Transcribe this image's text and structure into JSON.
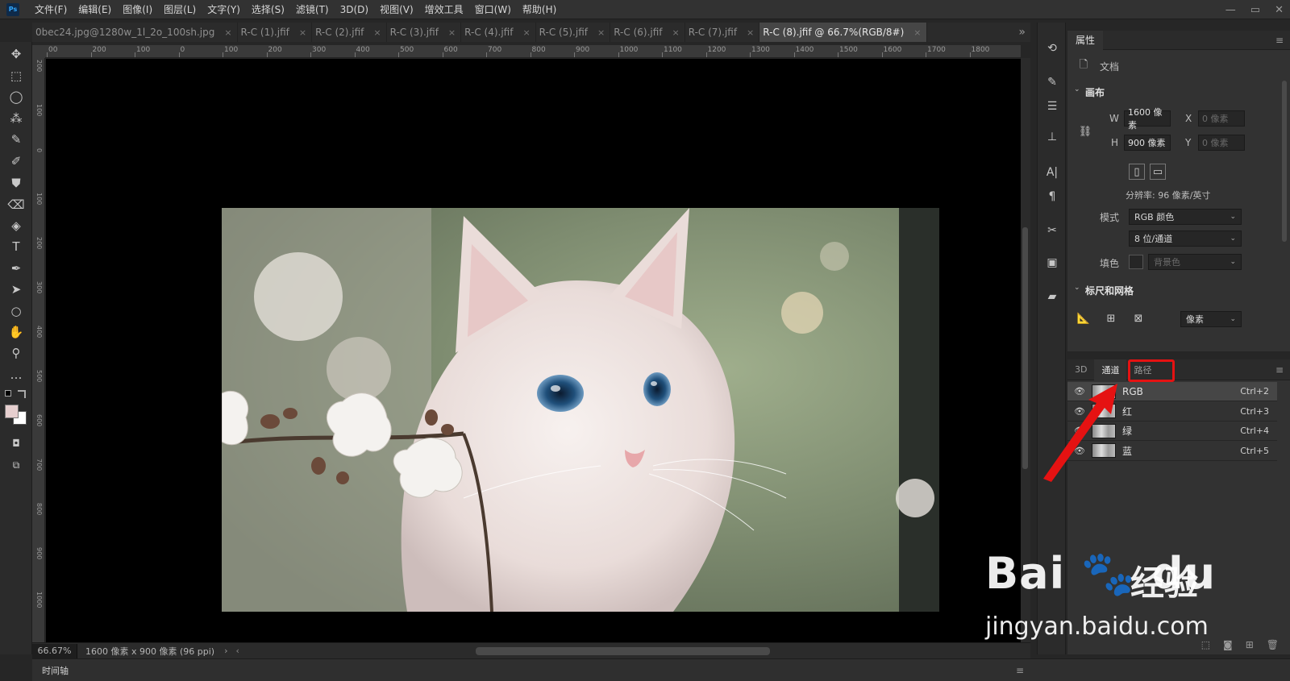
{
  "app": {
    "logo": "Ps"
  },
  "menu": [
    "文件(F)",
    "编辑(E)",
    "图像(I)",
    "图层(L)",
    "文字(Y)",
    "选择(S)",
    "滤镜(T)",
    "3D(D)",
    "视图(V)",
    "增效工具",
    "窗口(W)",
    "帮助(H)"
  ],
  "window_controls": {
    "minimize": "—",
    "restore": "▭",
    "close": "✕"
  },
  "tabs": [
    {
      "label": "0bec24.jpg@1280w_1l_2o_100sh.jpg",
      "close": "×"
    },
    {
      "label": "R-C (1).jfif",
      "close": "×"
    },
    {
      "label": "R-C (2).jfif",
      "close": "×"
    },
    {
      "label": "R-C (3).jfif",
      "close": "×"
    },
    {
      "label": "R-C (4).jfif",
      "close": "×"
    },
    {
      "label": "R-C (5).jfif",
      "close": "×"
    },
    {
      "label": "R-C (6).jfif",
      "close": "×"
    },
    {
      "label": "R-C (7).jfif",
      "close": "×"
    },
    {
      "label": "R-C (8).jfif @ 66.7%(RGB/8#)",
      "close": "×",
      "active": true
    }
  ],
  "tab_overflow": "»",
  "tools": [
    {
      "name": "move-tool",
      "glyph": "✥"
    },
    {
      "name": "marquee-tool",
      "glyph": "⬚"
    },
    {
      "name": "lasso-tool",
      "glyph": "◯"
    },
    {
      "name": "magic-wand-tool",
      "glyph": "⁂"
    },
    {
      "name": "eyedropper-tool",
      "glyph": "✎"
    },
    {
      "name": "brush-tool",
      "glyph": "✐"
    },
    {
      "name": "stamp-tool",
      "glyph": "⛊"
    },
    {
      "name": "eraser-tool",
      "glyph": "⌫"
    },
    {
      "name": "paint-bucket-tool",
      "glyph": "◈"
    },
    {
      "name": "type-tool",
      "glyph": "T"
    },
    {
      "name": "pen-tool",
      "glyph": "✒"
    },
    {
      "name": "path-select-tool",
      "glyph": "➤"
    },
    {
      "name": "ellipse-tool",
      "glyph": "○"
    },
    {
      "name": "hand-tool",
      "glyph": "✋"
    },
    {
      "name": "zoom-tool",
      "glyph": "⚲"
    },
    {
      "name": "more-tools",
      "glyph": "…"
    }
  ],
  "colors": {
    "foreground": "#e6cfcf",
    "background": "#ffffff",
    "highlight": "#e51212"
  },
  "ruler_top": [
    "00",
    "200",
    "100",
    "0",
    "100",
    "200",
    "300",
    "400",
    "500",
    "600",
    "700",
    "800",
    "900",
    "1000",
    "1100",
    "1200",
    "1300",
    "1400",
    "1500",
    "1600",
    "1700",
    "1800"
  ],
  "ruler_left": [
    "200",
    "100",
    "0",
    "100",
    "200",
    "300",
    "400",
    "500",
    "600",
    "700",
    "800",
    "900",
    "1000"
  ],
  "status": {
    "zoom": "66.67%",
    "doc_size": "1600 像素 x 900 像素 (96 ppi)",
    "arrow": "›",
    "scroll_left": "‹"
  },
  "timeline": {
    "label": "时间轴",
    "menu": "≡"
  },
  "properties": {
    "tab": "属性",
    "menu": "≡",
    "doc_label": "文档",
    "canvas_title": "画布",
    "w_label": "W",
    "w_value": "1600 像素",
    "h_label": "H",
    "h_value": "900 像素",
    "x_label": "X",
    "x_value": "0 像素",
    "y_label": "Y",
    "y_value": "0 像素",
    "resolution": "分辨率: 96 像素/英寸",
    "mode_label": "模式",
    "mode_value": "RGB 颜色",
    "depth_value": "8 位/通道",
    "fill_label": "填色",
    "fill_value": "背景色",
    "rulers_title": "标尺和网格",
    "units_value": "像素"
  },
  "channels_panel": {
    "tabs": [
      "3D",
      "通道",
      "路径"
    ],
    "menu": "≡",
    "rows": [
      {
        "name": "RGB",
        "shortcut": "Ctrl+2"
      },
      {
        "name": "红",
        "shortcut": "Ctrl+3"
      },
      {
        "name": "绿",
        "shortcut": "Ctrl+4"
      },
      {
        "name": "蓝",
        "shortcut": "Ctrl+5"
      }
    ],
    "bottom_icons": [
      "⬚",
      "◙",
      "⊞",
      "🗑"
    ]
  },
  "watermark": {
    "brand": "Bai 🐾 du",
    "jingyan": "经验",
    "url": "jingyan.baidu.com"
  }
}
